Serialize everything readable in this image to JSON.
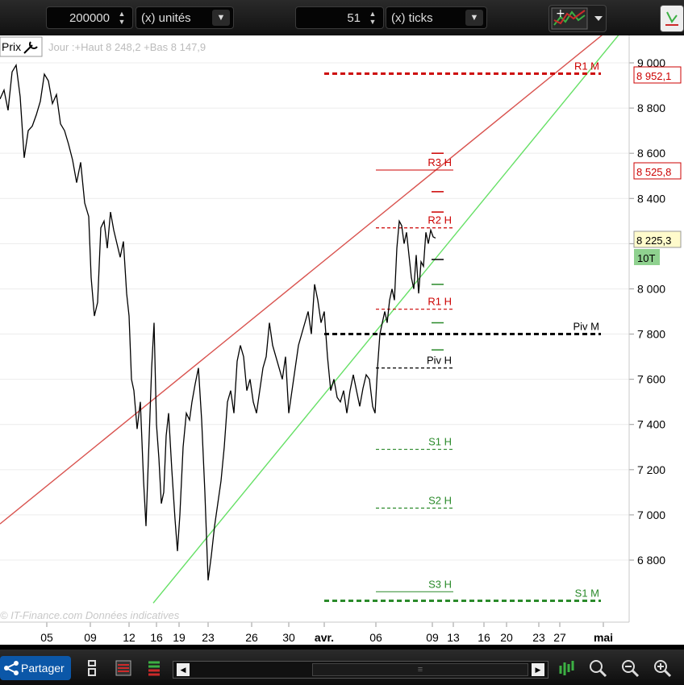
{
  "toolbar": {
    "quantity_value": "200000",
    "quantity_unit": "(x) unités",
    "ticks_value": "51",
    "ticks_unit": "(x) ticks"
  },
  "header": {
    "price_label": "Prix",
    "ohlc_text": "Jour :+Haut 8 248,2 +Bas 8 147,9"
  },
  "watermark": "© IT-Finance.com  Données indicatives",
  "price_tags": {
    "r1m": "8 952,1",
    "r3h": "8 525,8",
    "last": "8 225,3",
    "period": "10T"
  },
  "bottom": {
    "share_label": "Partager"
  },
  "chart_data": {
    "type": "line",
    "title": "",
    "ylim": [
      6500,
      9100
    ],
    "y_ticks": [
      6800,
      7000,
      7200,
      7400,
      7600,
      7800,
      8000,
      8200,
      8400,
      8600,
      8800,
      9000
    ],
    "y_tick_labels": [
      "6 800",
      "7 000",
      "7 200",
      "7 400",
      "7 600",
      "7 800",
      "8 000",
      "8 200",
      "8 400",
      "8 600",
      "8 800",
      "9 000"
    ],
    "x_tick_labels": [
      "05",
      "09",
      "12",
      "16",
      "19",
      "23",
      "26",
      "30",
      "avr.",
      "06",
      "09",
      "13",
      "16",
      "20",
      "23",
      "27",
      "mai"
    ],
    "series": [
      {
        "color": "#000000",
        "points": [
          [
            0,
            8840
          ],
          [
            5,
            8880
          ],
          [
            10,
            8790
          ],
          [
            15,
            8960
          ],
          [
            20,
            8990
          ],
          [
            25,
            8850
          ],
          [
            30,
            8580
          ],
          [
            35,
            8700
          ],
          [
            40,
            8720
          ],
          [
            45,
            8770
          ],
          [
            50,
            8830
          ],
          [
            55,
            8950
          ],
          [
            60,
            8920
          ],
          [
            65,
            8820
          ],
          [
            70,
            8860
          ],
          [
            75,
            8730
          ],
          [
            80,
            8700
          ],
          [
            85,
            8640
          ],
          [
            90,
            8570
          ],
          [
            95,
            8470
          ],
          [
            100,
            8560
          ],
          [
            105,
            8380
          ],
          [
            110,
            8320
          ],
          [
            113,
            8050
          ],
          [
            117,
            7880
          ],
          [
            121,
            7940
          ],
          [
            125,
            8270
          ],
          [
            129,
            8300
          ],
          [
            133,
            8180
          ],
          [
            137,
            8340
          ],
          [
            141,
            8260
          ],
          [
            145,
            8200
          ],
          [
            149,
            8140
          ],
          [
            153,
            8210
          ],
          [
            157,
            7980
          ],
          [
            160,
            7880
          ],
          [
            163,
            7600
          ],
          [
            166,
            7550
          ],
          [
            170,
            7380
          ],
          [
            174,
            7500
          ],
          [
            178,
            7150
          ],
          [
            181,
            6950
          ],
          [
            184,
            7250
          ],
          [
            188,
            7650
          ],
          [
            191,
            7850
          ],
          [
            194,
            7400
          ],
          [
            197,
            7250
          ],
          [
            200,
            7050
          ],
          [
            203,
            7100
          ],
          [
            206,
            7350
          ],
          [
            209,
            7450
          ],
          [
            213,
            7200
          ],
          [
            217,
            6980
          ],
          [
            220,
            6840
          ],
          [
            223,
            7000
          ],
          [
            227,
            7300
          ],
          [
            231,
            7450
          ],
          [
            235,
            7420
          ],
          [
            238,
            7500
          ],
          [
            242,
            7580
          ],
          [
            246,
            7650
          ],
          [
            250,
            7420
          ],
          [
            254,
            7100
          ],
          [
            258,
            6710
          ],
          [
            262,
            6820
          ],
          [
            266,
            6950
          ],
          [
            270,
            7050
          ],
          [
            274,
            7150
          ],
          [
            278,
            7300
          ],
          [
            282,
            7500
          ],
          [
            286,
            7550
          ],
          [
            290,
            7450
          ],
          [
            294,
            7680
          ],
          [
            298,
            7750
          ],
          [
            302,
            7700
          ],
          [
            306,
            7550
          ],
          [
            310,
            7600
          ],
          [
            314,
            7500
          ],
          [
            318,
            7450
          ],
          [
            322,
            7550
          ],
          [
            326,
            7650
          ],
          [
            330,
            7700
          ],
          [
            334,
            7850
          ],
          [
            338,
            7750
          ],
          [
            342,
            7700
          ],
          [
            346,
            7650
          ],
          [
            350,
            7600
          ],
          [
            354,
            7700
          ],
          [
            358,
            7450
          ],
          [
            362,
            7550
          ],
          [
            366,
            7650
          ],
          [
            370,
            7750
          ],
          [
            374,
            7800
          ],
          [
            378,
            7850
          ],
          [
            382,
            7900
          ],
          [
            386,
            7800
          ],
          [
            390,
            8020
          ],
          [
            394,
            7950
          ],
          [
            398,
            7850
          ],
          [
            402,
            7900
          ],
          [
            406,
            7700
          ],
          [
            410,
            7550
          ],
          [
            414,
            7600
          ],
          [
            418,
            7520
          ],
          [
            422,
            7500
          ],
          [
            426,
            7550
          ],
          [
            430,
            7450
          ],
          [
            434,
            7550
          ],
          [
            438,
            7620
          ],
          [
            442,
            7550
          ],
          [
            446,
            7480
          ],
          [
            450,
            7560
          ],
          [
            454,
            7620
          ],
          [
            458,
            7600
          ],
          [
            462,
            7480
          ],
          [
            465,
            7450
          ],
          [
            468,
            7650
          ],
          [
            471,
            7800
          ],
          [
            474,
            7850
          ],
          [
            477,
            7900
          ],
          [
            480,
            7850
          ],
          [
            483,
            7950
          ],
          [
            486,
            8000
          ],
          [
            489,
            7950
          ],
          [
            492,
            8180
          ],
          [
            495,
            8300
          ],
          [
            498,
            8280
          ],
          [
            501,
            8200
          ],
          [
            504,
            8250
          ],
          [
            507,
            8150
          ],
          [
            510,
            8050
          ],
          [
            513,
            8000
          ],
          [
            516,
            8150
          ],
          [
            519,
            7980
          ],
          [
            522,
            8120
          ],
          [
            525,
            8100
          ],
          [
            528,
            8250
          ],
          [
            531,
            8200
          ],
          [
            534,
            8260
          ],
          [
            537,
            8230
          ],
          [
            540,
            8225
          ]
        ]
      }
    ],
    "trendlines": [
      {
        "color": "#d9534f",
        "from": [
          0,
          6960
        ],
        "to": [
          780,
          9220
        ]
      },
      {
        "color": "#66e066",
        "from": [
          190,
          6610
        ],
        "to": [
          780,
          9180
        ]
      }
    ],
    "levels": [
      {
        "label": "R1 M",
        "value": 8952.1,
        "color": "#cc0000",
        "style": "dashed",
        "from": 402,
        "to": 745
      },
      {
        "label": "R3 H",
        "value": 8525.8,
        "color": "#cc0000",
        "style": "solid",
        "from": 466,
        "to": 562
      },
      {
        "label": "R2 H",
        "value": 8270,
        "color": "#cc0000",
        "style": "dashed",
        "from": 466,
        "to": 562
      },
      {
        "label": "R1 H",
        "value": 7910,
        "color": "#cc0000",
        "style": "dashed",
        "from": 466,
        "to": 562
      },
      {
        "label": "Piv M",
        "value": 7800,
        "color": "#000000",
        "style": "dashed-bold",
        "from": 402,
        "to": 745
      },
      {
        "label": "Piv H",
        "value": 7650,
        "color": "#000000",
        "style": "dashed",
        "from": 466,
        "to": 562
      },
      {
        "label": "S1 H",
        "value": 7290,
        "color": "#2a8a2a",
        "style": "dashed",
        "from": 466,
        "to": 562
      },
      {
        "label": "S2 H",
        "value": 7030,
        "color": "#2a8a2a",
        "style": "dashed",
        "from": 466,
        "to": 562
      },
      {
        "label": "S3 H",
        "value": 6660,
        "color": "#2a8a2a",
        "style": "solid",
        "from": 466,
        "to": 562
      },
      {
        "label": "S1 M",
        "value": 6620,
        "color": "#2a8a2a",
        "style": "dashed",
        "from": 402,
        "to": 745
      }
    ],
    "level_ticks": [
      {
        "value": 8600,
        "color": "#cc0000"
      },
      {
        "value": 8430,
        "color": "#cc0000"
      },
      {
        "value": 8340,
        "color": "#cc0000"
      },
      {
        "value": 8130,
        "color": "#000000"
      },
      {
        "value": 8020,
        "color": "#2a8a2a"
      },
      {
        "value": 7850,
        "color": "#2a8a2a"
      },
      {
        "value": 7730,
        "color": "#2a8a2a"
      }
    ]
  }
}
